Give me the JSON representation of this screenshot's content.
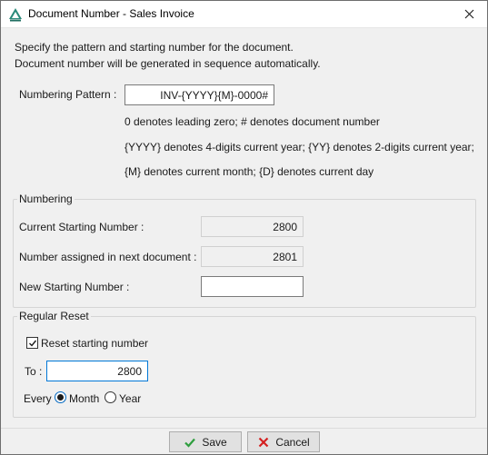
{
  "window": {
    "title": "Document Number - Sales Invoice"
  },
  "intro": {
    "line1": "Specify the pattern and starting number for the document.",
    "line2": "Document number will be generated in sequence automatically."
  },
  "pattern": {
    "label": "Numbering Pattern :",
    "value": "INV-{YYYY}{M}-0000#",
    "hint1": "0 denotes leading zero;  # denotes document number",
    "hint2": "{YYYY} denotes 4-digits current year;  {YY} denotes 2-digits current year;",
    "hint3": "{M} denotes current month;  {D} denotes current day"
  },
  "numbering": {
    "title": "Numbering",
    "current_label": "Current Starting Number :",
    "current_value": "2800",
    "next_label": "Number assigned in next document :",
    "next_value": "2801",
    "new_label": "New Starting Number :",
    "new_value": ""
  },
  "reset": {
    "title": "Regular Reset",
    "checkbox_label": "Reset starting number",
    "checked": true,
    "to_label": "To :",
    "to_value": "2800",
    "every_label": "Every",
    "month_label": "Month",
    "year_label": "Year",
    "selected": "Month"
  },
  "buttons": {
    "save": "Save",
    "cancel": "Cancel"
  },
  "colors": {
    "accent": "#0078d7",
    "save_icon": "#2e9e3e",
    "cancel_icon": "#d42020",
    "app_icon": "#2a8a7a"
  },
  "icons": {
    "app": "app-logo-icon",
    "close": "close-icon",
    "save": "checkmark-icon",
    "cancel": "x-mark-icon"
  }
}
